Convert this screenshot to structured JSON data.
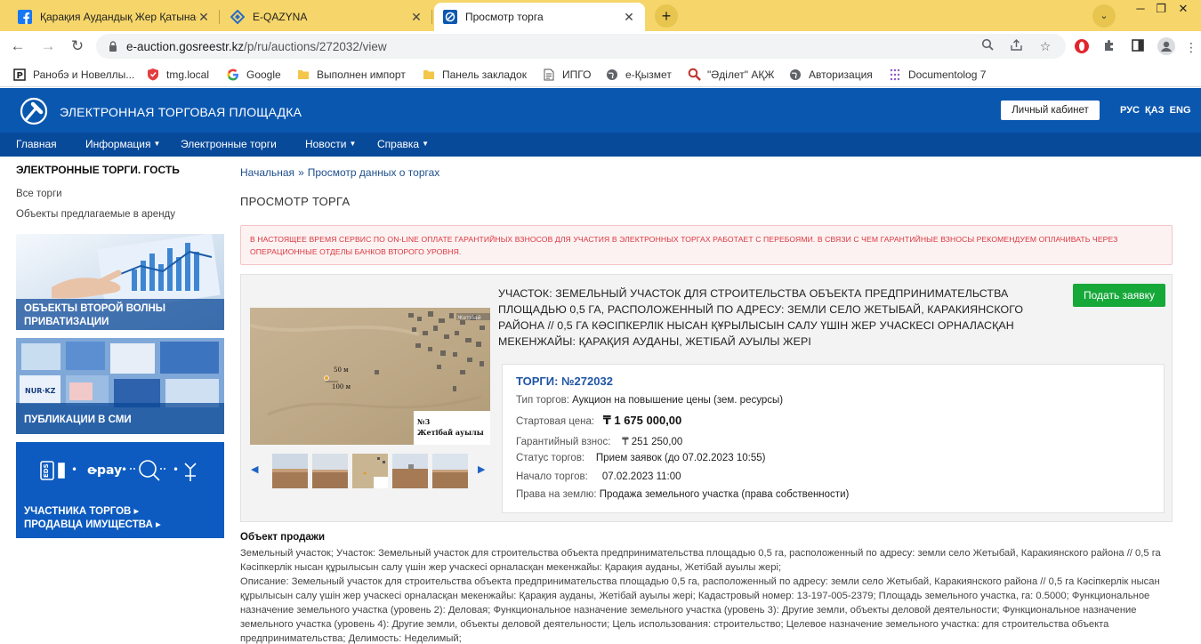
{
  "browser": {
    "tabs": [
      {
        "label": "Қарақия Аудандық Жер Қатынастар",
        "icon": "facebook-icon",
        "active": false
      },
      {
        "label": "E-QAZYNA",
        "icon": "eqazyna-icon",
        "active": false
      },
      {
        "label": "Просмотр торга",
        "icon": "gosreestr-icon",
        "active": true
      }
    ],
    "url_host": "e-auction.gosreestr.kz",
    "url_path": "/p/ru/auctions/272032/view",
    "bookmarks": [
      {
        "label": "Ранобэ и Новеллы...",
        "icon": "ranobe-icon"
      },
      {
        "label": "tmg.local",
        "icon": "shield-icon"
      },
      {
        "label": "Google",
        "icon": "google-icon"
      },
      {
        "label": "Выполнен импорт",
        "icon": "folder-icon"
      },
      {
        "label": "Панель закладок",
        "icon": "folder-icon"
      },
      {
        "label": "ИПГО",
        "icon": "document-icon"
      },
      {
        "label": "e-Қызмет",
        "icon": "globe-icon"
      },
      {
        "label": "\"Әділет\" АҚЖ",
        "icon": "search-icon"
      },
      {
        "label": "Авторизация",
        "icon": "globe-icon"
      },
      {
        "label": "Documentolog 7",
        "icon": "grid-icon"
      }
    ]
  },
  "site": {
    "title": "ЭЛЕКТРОННАЯ ТОРГОВАЯ ПЛОЩАДКА",
    "cabinet_label": "Личный кабинет",
    "languages": [
      "РУС",
      "ҚАЗ",
      "ENG"
    ],
    "nav": [
      {
        "label": "Главная",
        "caret": false
      },
      {
        "label": "Информация",
        "caret": true
      },
      {
        "label": "Электронные торги",
        "caret": false
      },
      {
        "label": "Новости",
        "caret": true
      },
      {
        "label": "Справка",
        "caret": true
      }
    ],
    "brand_color": "#0a57b0"
  },
  "sidebar": {
    "title": "ЭЛЕКТРОННЫЕ ТОРГИ. ГОСТЬ",
    "links": [
      "Все торги",
      "Объекты предлагаемые в аренду"
    ],
    "banners": [
      {
        "line1": "ОБЪЕКТЫ ВТОРОЙ ВОЛНЫ",
        "line2": "ПРИВАТИЗАЦИИ"
      },
      {
        "line1": "ПУБЛИКАЦИИ В СМИ",
        "line2": ""
      },
      {
        "line1": "УЧАСТНИКА ТОРГОВ ▸",
        "line2": "ПРОДАВЦА ИМУЩЕСТВА ▸",
        "badges": [
          "EDS",
          "e pay"
        ]
      }
    ]
  },
  "content": {
    "breadcrumb": [
      "Начальная",
      "Просмотр данных о торгах"
    ],
    "breadcrumb_sep": "»",
    "page_title": "ПРОСМОТР ТОРГА",
    "alert": "В НАСТОЯЩЕЕ ВРЕМЯ СЕРВИС ПО ON-LINE ОПЛАТЕ ГАРАНТИЙНЫХ ВЗНОСОВ ДЛЯ УЧАСТИЯ В ЭЛЕКТРОННЫХ ТОРГАХ РАБОТАЕТ С ПЕРЕБОЯМИ. В СВЯЗИ С ЧЕМ ГАРАНТИЙНЫЕ ВЗНОСЫ РЕКОМЕНДУЕМ ОПЛАЧИВАТЬ ЧЕРЕЗ ОПЕРАЦИОННЫЕ ОТДЕЛЫ БАНКОВ ВТОРОГО УРОВНЯ.",
    "lot": {
      "heading": "УЧАСТОК: ЗЕМЕЛЬНЫЙ УЧАСТОК ДЛЯ СТРОИТЕЛЬСТВА ОБЪЕКТА ПРЕДПРИНИМАТЕЛЬСТВА ПЛОЩАДЬЮ 0,5 ГА, РАСПОЛОЖЕННЫЙ ПО АДРЕСУ: ЗЕМЛИ СЕЛО ЖЕТЫБАЙ, КАРАКИЯНСКОГО РАЙОНА // 0,5 ГА КӘСІПКЕРЛІК НЫСАН ҚҰРЫЛЫСЫН САЛУ ҮШІН ЖЕР УЧАСКЕСІ ОРНАЛАСҚАН МЕКЕНЖАЙЫ: ҚАРАҚИЯ АУДАНЫ, ЖЕТІБАЙ АУЫЛЫ ЖЕРІ",
      "apply_label": "Подать заявку",
      "photo": {
        "label_50": "50 м",
        "label_100": "100 м",
        "map_title": "№3",
        "map_subtitle": "Жетібай ауылы"
      },
      "number_label": "ТОРГИ: №272032",
      "rows": [
        {
          "label": "Тип торгов:",
          "value": "Аукцион на повышение цены (зем. ресурсы)"
        },
        {
          "label": "Стартовая цена:",
          "value": "₸ 1 675 000,00"
        },
        {
          "label": "Гарантийный взнос:",
          "value": "₸ 251 250,00"
        },
        {
          "label": "Статус торгов:",
          "value": "Прием заявок (до 07.02.2023 10:55)"
        },
        {
          "label": "Начало торгов:",
          "value": "07.02.2023 11:00"
        },
        {
          "label": "Права на землю:",
          "value": "Продажа земельного участка (права собственности)"
        }
      ]
    },
    "object": {
      "title": "Объект продажи",
      "text": "Земельный участок; Участок: Земельный участок для строительства объекта предпринимательства площадью 0,5 га, расположенный по адресу: земли село Жетыбай, Каракиянского района // 0,5 га Кәсіпкерлік нысан құрылысын салу үшін жер учаскесі орналасқан мекенжайы: Қарақия ауданы, Жетібай ауылы жері;",
      "text2": "Описание: Земельный участок для строительства объекта предпринимательства площадью 0,5 га, расположенный по адресу: земли село Жетыбай, Каракиянского района // 0,5 га Кәсіпкерлік нысан құрылысын салу үшін жер учаскесі орналасқан мекенжайы: Қарақия ауданы, Жетібай ауылы жері; Кадастровый номер: 13-197-005-2379; Площадь земельного участка, га: 0.5000; Функциональное назначение земельного участка (уровень 2): Деловая; Функциональное назначение земельного участка (уровень 3): Другие земли, объекты деловой деятельности; Функциональное назначение земельного участка (уровень 4): Другие земли, объекты деловой деятельности; Цель использования: строительство; Целевое назначение земельного участка: для строительства объекта предпринимательства; Делимость: Неделимый;"
    }
  }
}
